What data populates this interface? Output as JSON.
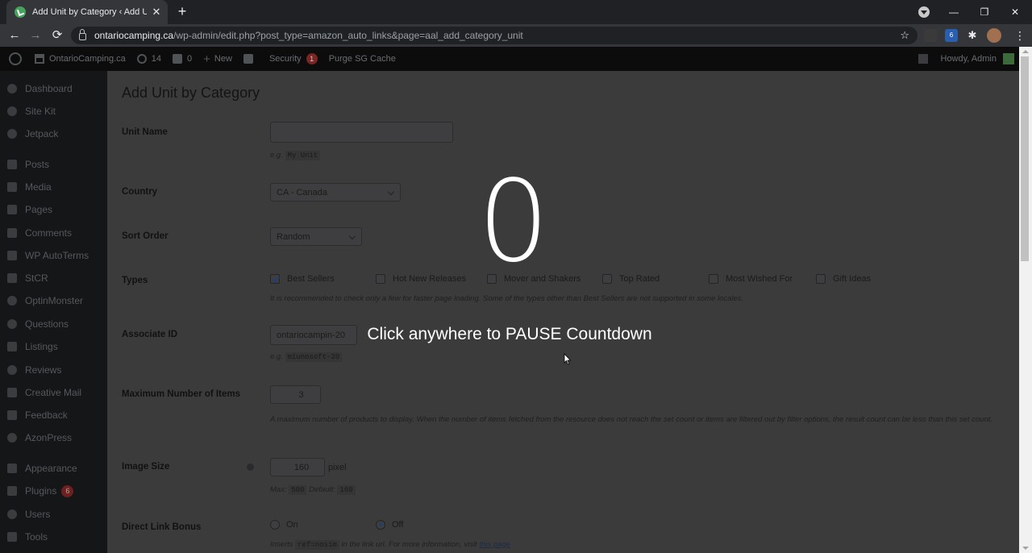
{
  "browser": {
    "tab_title": "Add Unit by Category ‹ Add Unit",
    "tab_close": "✕",
    "new_tab": "+",
    "url_host": "ontariocamping.ca",
    "url_path": "/wp-admin/edit.php?post_type=amazon_auto_links&page=aal_add_category_unit",
    "back": "←",
    "forward": "→",
    "reload": "⟳",
    "bookmark": "☆",
    "menu": "⋮",
    "extension_badge": "6",
    "window_controls": {
      "minimize": "—",
      "restore": "❐",
      "close": "✕"
    }
  },
  "adminbar": {
    "site_name": "OntarioCamping.ca",
    "updates_count": "14",
    "comments_count": "0",
    "new_label": "New",
    "security_label": "Security",
    "security_count": "1",
    "purge_label": "Purge SG Cache",
    "howdy": "Howdy, Admin"
  },
  "sidebar": {
    "items": [
      {
        "label": "Dashboard"
      },
      {
        "label": "Site Kit"
      },
      {
        "label": "Jetpack"
      },
      {
        "label": "Posts"
      },
      {
        "label": "Media"
      },
      {
        "label": "Pages"
      },
      {
        "label": "Comments"
      },
      {
        "label": "WP AutoTerms"
      },
      {
        "label": "StCR"
      },
      {
        "label": "OptinMonster"
      },
      {
        "label": "Questions"
      },
      {
        "label": "Listings"
      },
      {
        "label": "Reviews"
      },
      {
        "label": "Creative Mail"
      },
      {
        "label": "Feedback"
      },
      {
        "label": "AzonPress"
      },
      {
        "label": "Appearance"
      },
      {
        "label": "Plugins",
        "badge": "6"
      },
      {
        "label": "Users"
      },
      {
        "label": "Tools"
      }
    ]
  },
  "form": {
    "page_title": "Add Unit by Category",
    "unit_name": {
      "label": "Unit Name",
      "value": "",
      "hint_prefix": "e.g.",
      "hint_code": "My Unit"
    },
    "country": {
      "label": "Country",
      "selected": "CA - Canada"
    },
    "sort_order": {
      "label": "Sort Order",
      "selected": "Random"
    },
    "types": {
      "label": "Types",
      "options": [
        {
          "label": "Best Sellers",
          "checked": true
        },
        {
          "label": "Hot New Releases",
          "checked": false
        },
        {
          "label": "Mover and Shakers",
          "checked": false
        },
        {
          "label": "Top Rated",
          "checked": false
        },
        {
          "label": "Most Wished For",
          "checked": false
        },
        {
          "label": "Gift Ideas",
          "checked": false
        }
      ],
      "hint": "It is recommended to check only a few for faster page loading. Some of the types other than Best Sellers are not supported in some locales."
    },
    "associate_id": {
      "label": "Associate ID",
      "value": "ontariocampin-20",
      "hint_prefix": "e.g.",
      "hint_code": "miunosoft-20"
    },
    "max_items": {
      "label": "Maximum Number of Items",
      "value": "3",
      "hint": "A maximum number of products to display. When the number of items fetched from the resource does not reach the set count or items are filtered out by filter options, the result count can be less than this set count."
    },
    "image_size": {
      "label": "Image Size",
      "value": "160",
      "unit": "pixel",
      "max_label": "Max:",
      "max_value": "500",
      "default_label": "Default:",
      "default_value": "160"
    },
    "direct_link_bonus": {
      "label": "Direct Link Bonus",
      "on_label": "On",
      "off_label": "Off",
      "selected": "Off",
      "hint_prefix": "Inserts",
      "hint_code": "ref=nosim",
      "hint_middle": "in the link url. For more information, visit",
      "hint_link": "this page"
    }
  },
  "overlay": {
    "countdown": "0",
    "message": "Click anywhere to PAUSE Countdown"
  }
}
